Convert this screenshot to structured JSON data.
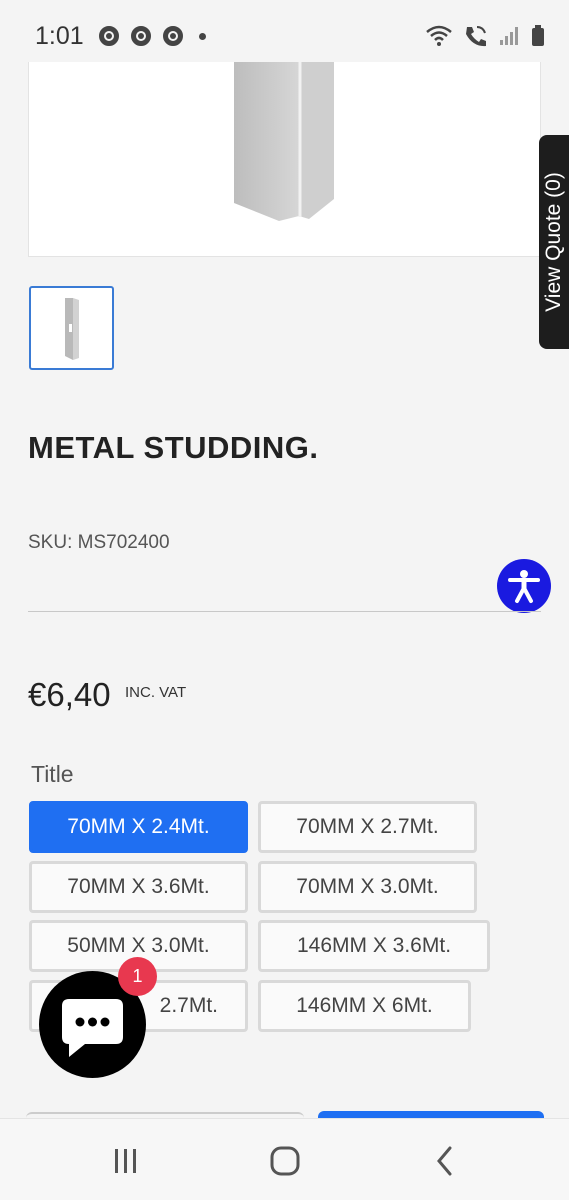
{
  "status_bar": {
    "time": "1:01",
    "app_icons": [
      "chrome-icon",
      "chrome-icon",
      "chrome-icon"
    ],
    "right_icons": [
      "wifi-icon",
      "wifi-calling-icon",
      "signal-icon",
      "battery-icon"
    ]
  },
  "product": {
    "image_alt": "metal-stud-image",
    "title": "METAL STUDDING.",
    "sku": "SKU: MS702400",
    "price": "€6,40",
    "price_note": "INC. VAT"
  },
  "view_quote": {
    "label": "View Quote (0)"
  },
  "options": {
    "title": "Title",
    "selected": "70MM X 2.4Mt.",
    "items": [
      "70MM X 2.4Mt.",
      "70MM X 2.7Mt.",
      "70MM X 3.6Mt.",
      "70MM X 3.0Mt.",
      "50MM X 3.0Mt.",
      "146MM X 3.6Mt.",
      "2.7Mt.",
      "146MM X 6Mt."
    ]
  },
  "chat": {
    "badge_count": "1"
  },
  "colors": {
    "accent": "#1f6ff2",
    "accessibility": "#1a1ae0",
    "badge": "#e8384f",
    "quote_tab": "#1d1d1d"
  },
  "nav": {
    "icons": [
      "recent-apps-icon",
      "home-icon",
      "back-icon"
    ]
  }
}
